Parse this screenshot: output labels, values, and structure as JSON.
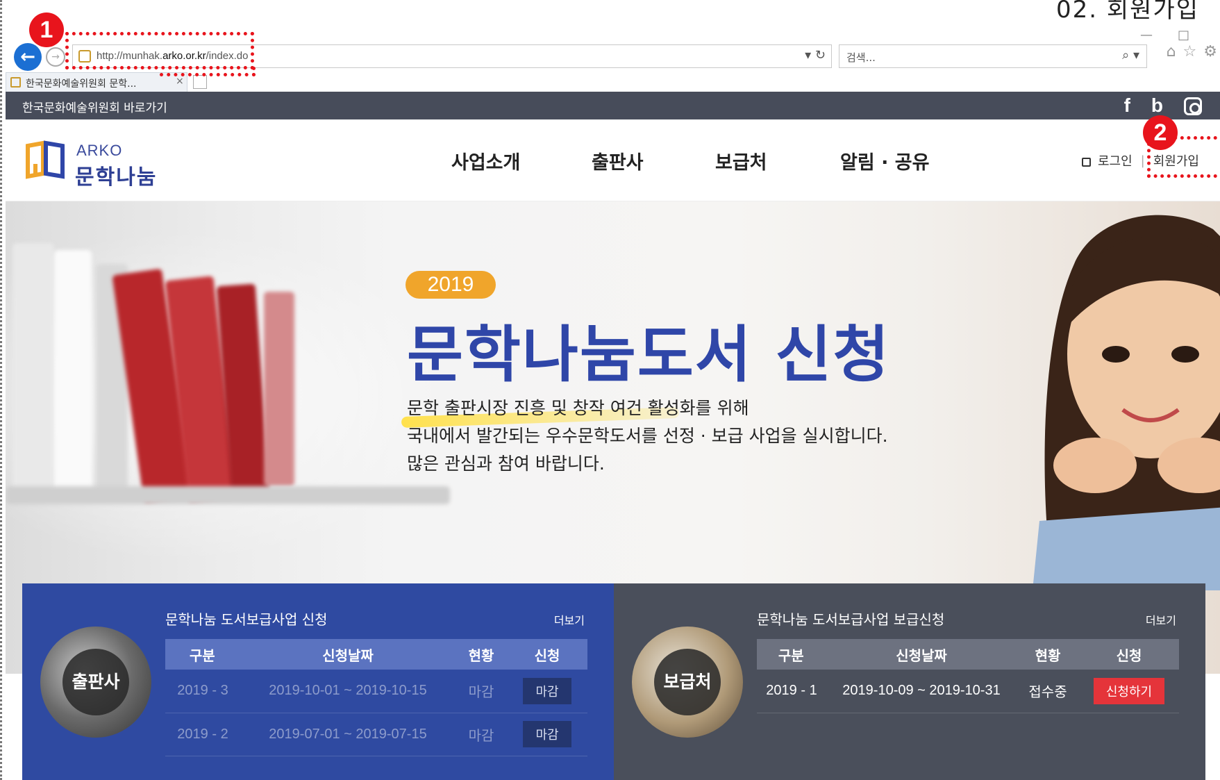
{
  "corner_label": "02. 회원가입",
  "browser": {
    "url_prefix": "http://munhak.",
    "url_domain": "arko.or.kr",
    "url_path": "/index.do",
    "url_tools": "▾ ↻",
    "search_placeholder": "검색...",
    "search_tools": "⌕ ▾",
    "tab_title": "한국문화예술위원회 문학...",
    "tab_close": "×",
    "back_glyph": "←",
    "forward_glyph": "→",
    "minimize_glyph": "—",
    "maximize_glyph": "□",
    "icons": [
      "home-icon",
      "star-icon",
      "gear-icon"
    ],
    "icon_glyphs": [
      "⌂",
      "☆",
      "⚙"
    ]
  },
  "annotations": {
    "marker1": "1",
    "marker2": "2"
  },
  "topbar": {
    "label": "한국문화예술위원회 바로가기",
    "social": [
      "f",
      "b"
    ]
  },
  "header": {
    "logo_top": "ARKO",
    "logo_bottom": "문학나눔",
    "nav": [
      "사업소개",
      "출판사",
      "보급처",
      "알림 · 공유"
    ],
    "login": "로그인",
    "signup": "회원가입"
  },
  "hero": {
    "year": "2019",
    "title": "문학나눔도서 신청",
    "lines": [
      "문학 출판시장 진흥 및 창작 여건 활성화를 위해",
      "국내에서 발간되는 우수문학도서를 선정 · 보급 사업을 실시합니다.",
      "많은 관심과 참여 바랍니다."
    ]
  },
  "panel_publisher": {
    "badge": "출판사",
    "title": "문학나눔 도서보급사업 신청",
    "more": "더보기",
    "headers": [
      "구분",
      "신청날짜",
      "현황",
      "신청"
    ],
    "rows": [
      {
        "period": "2019 - 3",
        "dates": "2019-10-01 ~ 2019-10-15",
        "status": "마감",
        "action": "마감"
      },
      {
        "period": "2019 - 2",
        "dates": "2019-07-01 ~ 2019-07-15",
        "status": "마감",
        "action": "마감"
      }
    ]
  },
  "panel_library": {
    "badge": "보급처",
    "title": "문학나눔 도서보급사업 보급신청",
    "more": "더보기",
    "headers": [
      "구분",
      "신청날짜",
      "현황",
      "신청"
    ],
    "rows": [
      {
        "period": "2019 - 1",
        "dates": "2019-10-09 ~ 2019-10-31",
        "status": "접수중",
        "action": "신청하기"
      }
    ]
  },
  "colors": {
    "annotation_red": "#e8141c",
    "topbar": "#474c5a",
    "brand_blue": "#2f4aa1",
    "panel_gray": "#4a4f5b",
    "year_orange": "#f0a52b",
    "apply_red": "#e5343a"
  }
}
